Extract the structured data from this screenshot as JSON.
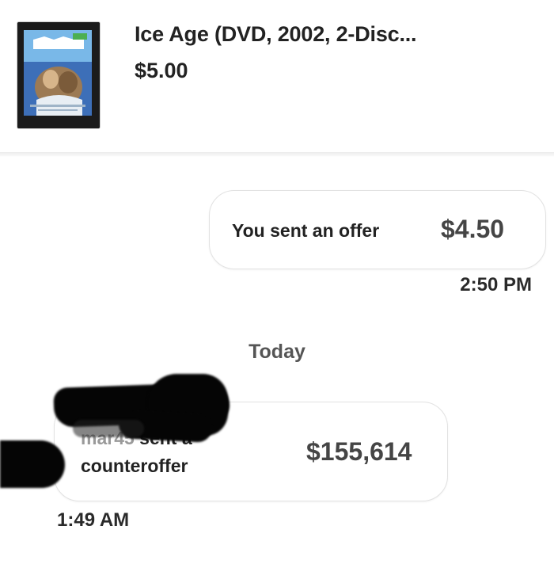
{
  "listing": {
    "title": "Ice Age (DVD, 2002, 2-Disc...",
    "price": "$5.00",
    "thumbnail_icon": "ice-age-dvd-cover"
  },
  "messages": {
    "sent": {
      "label": "You sent an offer",
      "amount": "$4.50",
      "time": "2:50 PM"
    },
    "day_separator": "Today",
    "received": {
      "user": "mar45",
      "line1_suffix": "sent a",
      "line2": "counteroffer",
      "amount": "$155,614",
      "time": "1:49 AM"
    }
  },
  "colors": {
    "background": "#ffffff",
    "bubble_border": "#e2e2e2",
    "text": "#222222",
    "amount_text": "#454545",
    "muted_text": "#555555"
  }
}
